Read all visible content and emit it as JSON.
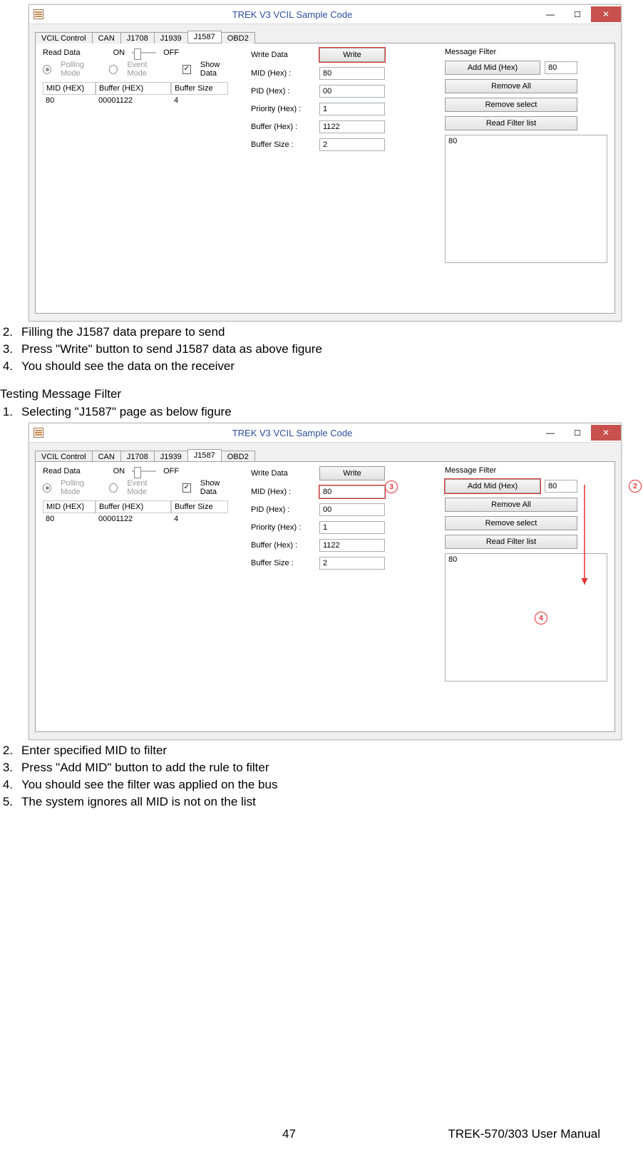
{
  "instructions1": [
    {
      "n": "2.",
      "t": "Filling the J1587 data prepare to send"
    },
    {
      "n": "3.",
      "t": "Press \"Write\" button to send J1587 data as above figure"
    },
    {
      "n": "4.",
      "t": "You should see the data on the receiver"
    }
  ],
  "section2_title": "Testing Message Filter",
  "instructions2a": [
    {
      "n": "1.",
      "t": "Selecting \"J1587\" page as below figure"
    }
  ],
  "instructions2b": [
    {
      "n": "2.",
      "t": "Enter specified MID to filter"
    },
    {
      "n": "3.",
      "t": "Press \"Add MID\" button to add the rule to filter"
    },
    {
      "n": "4.",
      "t": "You should see the filter was applied on the bus"
    },
    {
      "n": "5.",
      "t": "The system ignores all MID is not on the list"
    }
  ],
  "win": {
    "title": "TREK V3 VCIL Sample Code",
    "tabs": [
      "VCIL Control",
      "CAN",
      "J1708",
      "J1939",
      "J1587",
      "OBD2"
    ],
    "active_tab": "J1587",
    "read": {
      "label": "Read Data",
      "on": "ON",
      "off": "OFF",
      "polling": "Polling Mode",
      "event": "Event Mode",
      "show": "Show Data",
      "cols": [
        "MID (HEX)",
        "Buffer (HEX)",
        "Buffer Size"
      ],
      "row": [
        "80",
        "00001122",
        "4"
      ]
    },
    "write": {
      "label": "Write Data",
      "btn": "Write",
      "fields": [
        {
          "l": "MID (Hex) :",
          "v": "80"
        },
        {
          "l": "PID (Hex) :",
          "v": "00"
        },
        {
          "l": "Priority (Hex) :",
          "v": "1"
        },
        {
          "l": "Buffer (Hex) :",
          "v": "1122"
        },
        {
          "l": "Buffer Size :",
          "v": "2"
        }
      ]
    },
    "filter": {
      "label": "Message Filter",
      "addbtn": "Add Mid (Hex)",
      "addval": "80",
      "removeall": "Remove All",
      "removesel": "Remove select",
      "readlist": "Read Filter list",
      "list": "80"
    }
  },
  "callouts": {
    "c2": "2",
    "c3": "3",
    "c4": "4"
  },
  "footer": {
    "page": "47",
    "doc": "TREK-570/303 User Manual"
  }
}
